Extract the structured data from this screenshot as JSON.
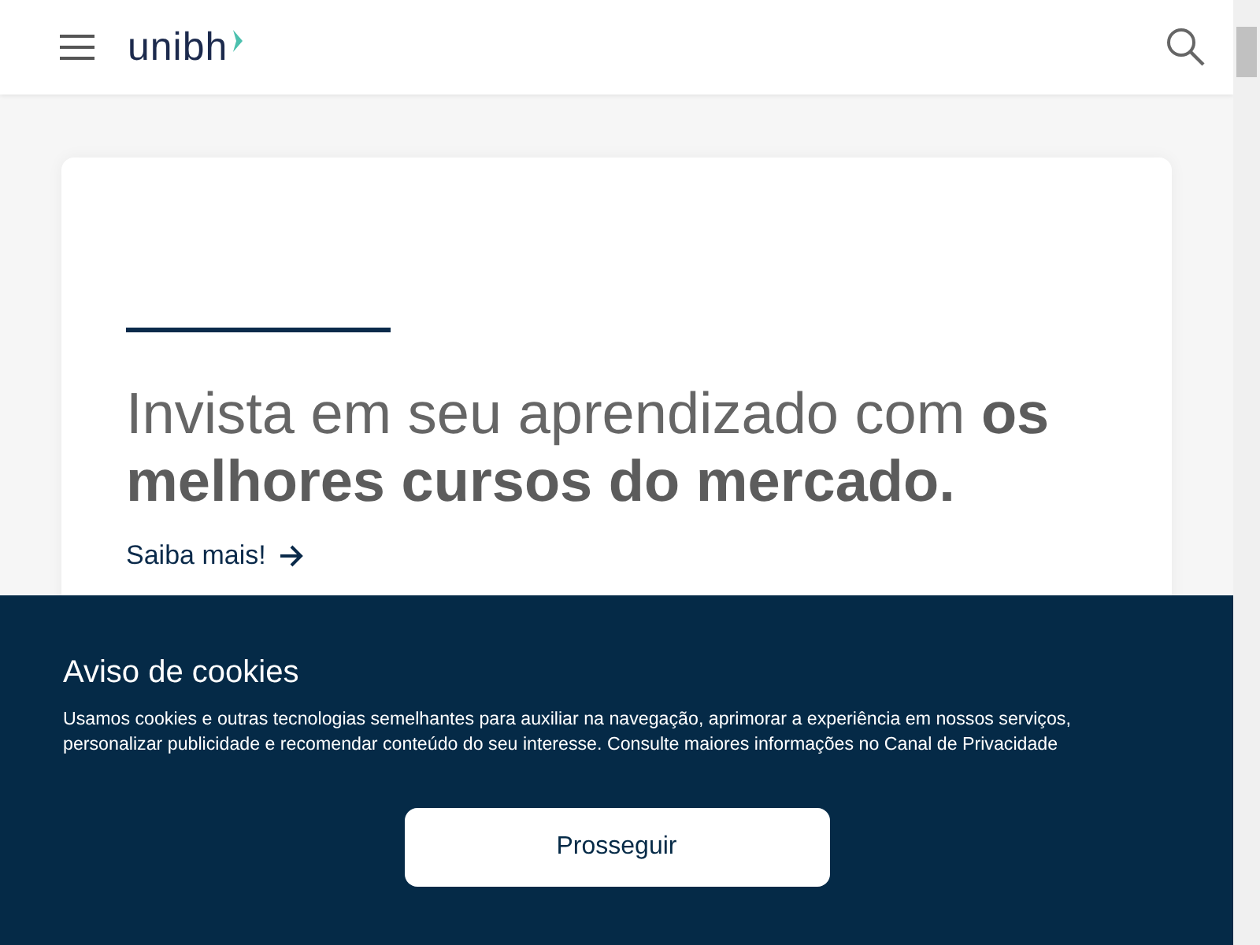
{
  "header": {
    "logo": "unibh"
  },
  "hero": {
    "headline": "Invista em seu aprendizado com **os melhores cursos do mercado.**",
    "link": "Saiba mais!"
  },
  "cookie_banner": {
    "title": "Aviso de cookies",
    "text": "Usamos cookies e outras tecnologias semelhantes para auxiliar na navegação, aprimorar a experiência em nossos serviços, personalizar publicidade e recomendar conteúdo do seu interesse. Consulte maiores informações no Canal de Privacidade",
    "button": "Prosseguir"
  }
}
